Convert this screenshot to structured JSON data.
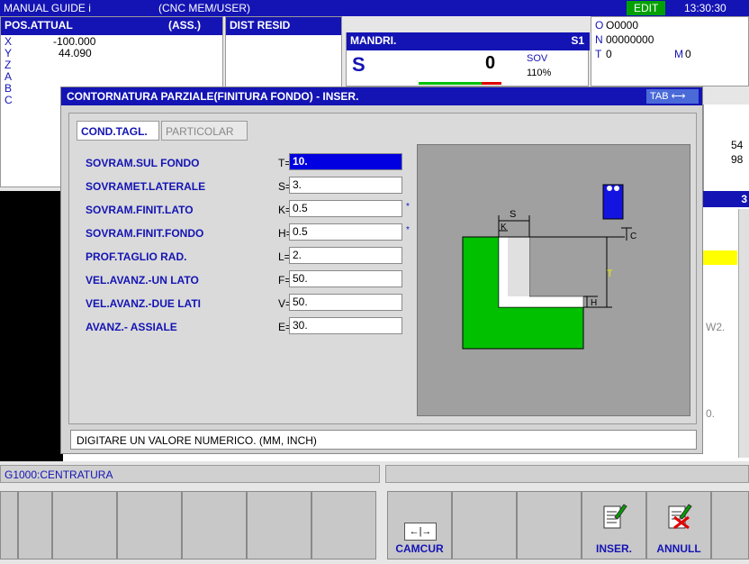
{
  "topbar": {
    "mode": "MANUAL GUIDE i",
    "path": "(CNC  MEM/USER)",
    "edit": "EDIT",
    "time": "13:30:30"
  },
  "pos": {
    "title": "POS.ATTUAL",
    "ass": "(ASS.)",
    "axes": [
      {
        "axis": "X",
        "value": "-100.000"
      },
      {
        "axis": "Y",
        "value": "44.090"
      },
      {
        "axis": "Z",
        "value": ""
      },
      {
        "axis": "A",
        "value": ""
      },
      {
        "axis": "B",
        "value": ""
      },
      {
        "axis": "C",
        "value": ""
      }
    ]
  },
  "dist": {
    "title": "DIST RESID"
  },
  "spindle": {
    "title": "MANDRI.",
    "s1": "S1",
    "s_label": "S",
    "s_value": "0",
    "sov": "SOV",
    "sov_pct": "110%"
  },
  "prog": {
    "o_label": "O",
    "o_value": "O0000",
    "n_label": "N",
    "n_value": "00000000",
    "t_label": "T",
    "t_value": "0",
    "m_label": "M",
    "m_value": "0"
  },
  "right_bg": {
    "v1": "54",
    "v2": "98",
    "v3": "3",
    "w2": "W2.",
    "o": "0."
  },
  "dialog": {
    "title": "CONTORNATURA PARZIALE(FINITURA FONDO) - INSER.",
    "tab_hint": "TAB ⟷",
    "tabs": [
      "COND.TAGL.",
      "PARTICOLAR"
    ],
    "fields": [
      {
        "label": "SOVRAM.SUL FONDO",
        "letter": "T=",
        "value": "10.",
        "star": ""
      },
      {
        "label": "SOVRAMET.LATERALE",
        "letter": "S=",
        "value": "3.",
        "star": ""
      },
      {
        "label": "SOVRAM.FINIT.LATO",
        "letter": "K=",
        "value": "0.5",
        "star": "*"
      },
      {
        "label": "SOVRAM.FINIT.FONDO",
        "letter": "H=",
        "value": "0.5",
        "star": "*"
      },
      {
        "label": "PROF.TAGLIO RAD.",
        "letter": "L=",
        "value": "2.",
        "star": ""
      },
      {
        "label": "VEL.AVANZ.-UN LATO",
        "letter": "F=",
        "value": "50.",
        "star": ""
      },
      {
        "label": "VEL.AVANZ.-DUE LATI",
        "letter": "V=",
        "value": "50.",
        "star": ""
      },
      {
        "label": "AVANZ.- ASSIALE",
        "letter": "E=",
        "value": "30.",
        "star": ""
      }
    ],
    "diagram_labels": {
      "s": "S",
      "k": "K",
      "c": "C",
      "t": "T",
      "h": "H"
    },
    "message": "DIGITARE UN VALORE NUMERICO. (MM, INCH)"
  },
  "status": {
    "left": "G1000:CENTRATURA",
    "right": ""
  },
  "softkeys": {
    "camcur": "CAMCUR",
    "camcur_icon": "←|→",
    "inser": "INSER.",
    "annull": "ANNULL"
  },
  "colors": {
    "accent": "#1414b4",
    "green": "#00c000",
    "highlight": "#ffff00"
  }
}
